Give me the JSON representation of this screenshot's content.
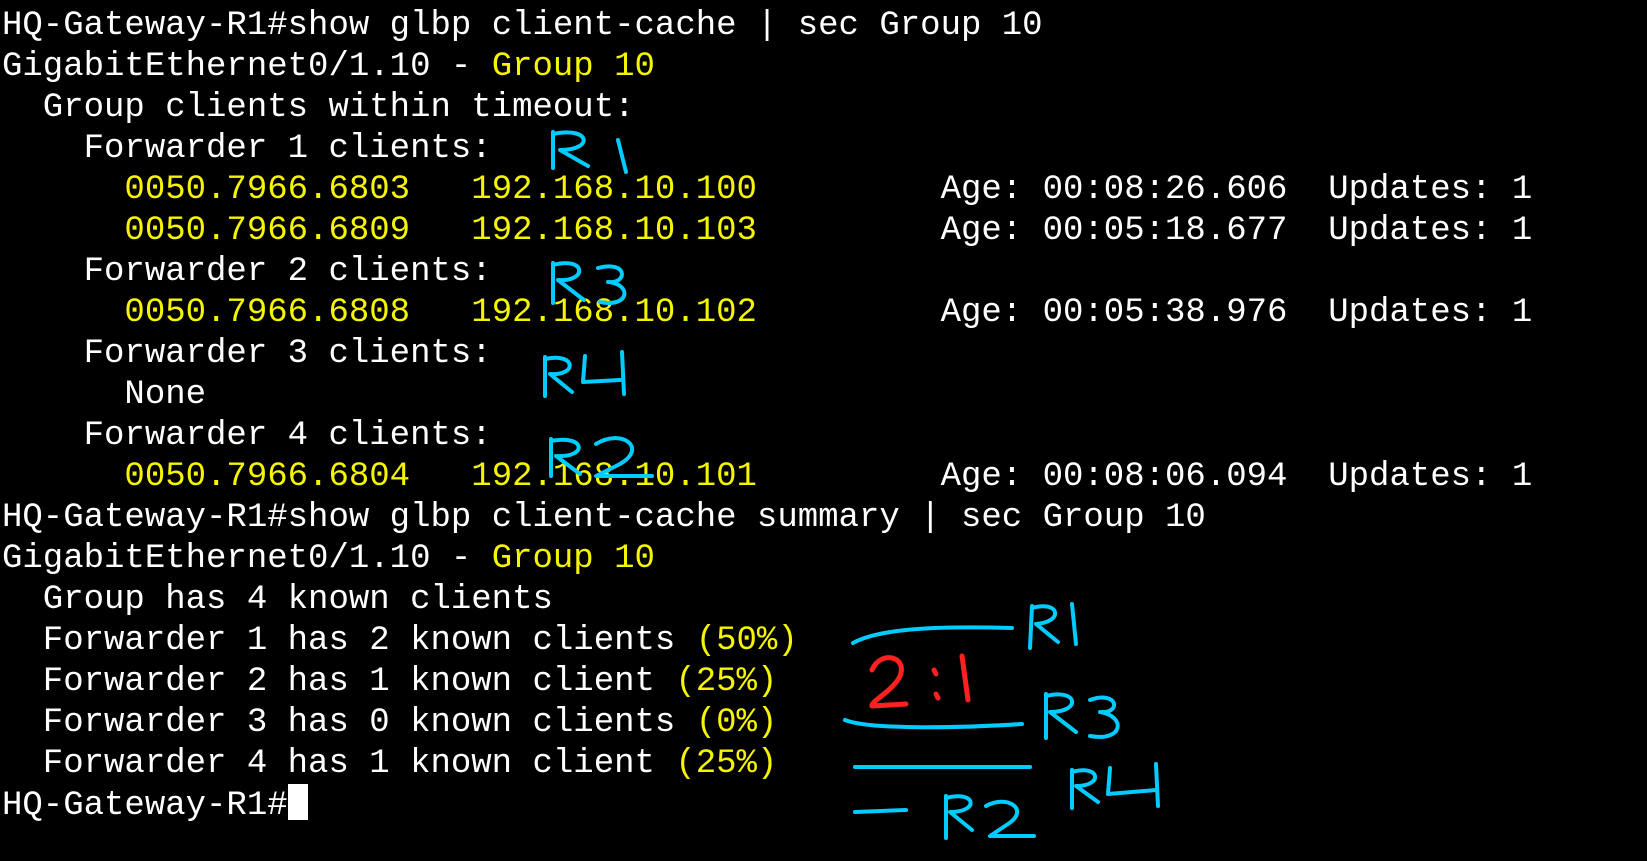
{
  "prompt": "HQ-Gateway-R1#",
  "commands": {
    "cmd1": "show glbp client-cache | sec Group 10",
    "cmd2": "show glbp client-cache summary | sec Group 10"
  },
  "interface": "GigabitEthernet0/1.10 - ",
  "group_label": "Group 10",
  "cache": {
    "header": "  Group clients within timeout:",
    "forwarders": [
      {
        "label": "    Forwarder 1 clients:",
        "annotation": "R1"
      },
      {
        "label": "    Forwarder 2 clients:",
        "annotation": "R3"
      },
      {
        "label": "    Forwarder 3 clients:",
        "annotation": "R4"
      },
      {
        "label": "    Forwarder 4 clients:",
        "annotation": "R2"
      }
    ],
    "clients": [
      {
        "mac": "      0050.7966.6803",
        "ip": "   192.168.10.100",
        "age": "         Age: 00:08:26.606",
        "updates": "  Updates: 1"
      },
      {
        "mac": "      0050.7966.6809",
        "ip": "   192.168.10.103",
        "age": "         Age: 00:05:18.677",
        "updates": "  Updates: 1"
      },
      {
        "mac": "      0050.7966.6808",
        "ip": "   192.168.10.102",
        "age": "         Age: 00:05:38.976",
        "updates": "  Updates: 1"
      },
      {
        "mac": "      0050.7966.6804",
        "ip": "   192.168.10.101",
        "age": "         Age: 00:08:06.094",
        "updates": "  Updates: 1"
      }
    ],
    "none_text": "      None"
  },
  "summary": {
    "group_line": "  Group has 4 known clients",
    "forwarders": [
      {
        "text": "  Forwarder 1 has 2 known clients ",
        "pct": "(50%)",
        "annotation": "R1"
      },
      {
        "text": "  Forwarder 2 has 1 known client ",
        "pct": "(25%)",
        "annotation": "R3"
      },
      {
        "text": "  Forwarder 3 has 0 known clients ",
        "pct": "(0%)",
        "annotation": "R4"
      },
      {
        "text": "  Forwarder 4 has 1 known client ",
        "pct": "(25%)",
        "annotation": "R2"
      }
    ],
    "ratio_annotation": "2:1"
  },
  "colors": {
    "background": "#000000",
    "text": "#ffffff",
    "highlight": "#f5f500",
    "annotation_cyan": "#00ccff",
    "annotation_red": "#ff2020"
  }
}
